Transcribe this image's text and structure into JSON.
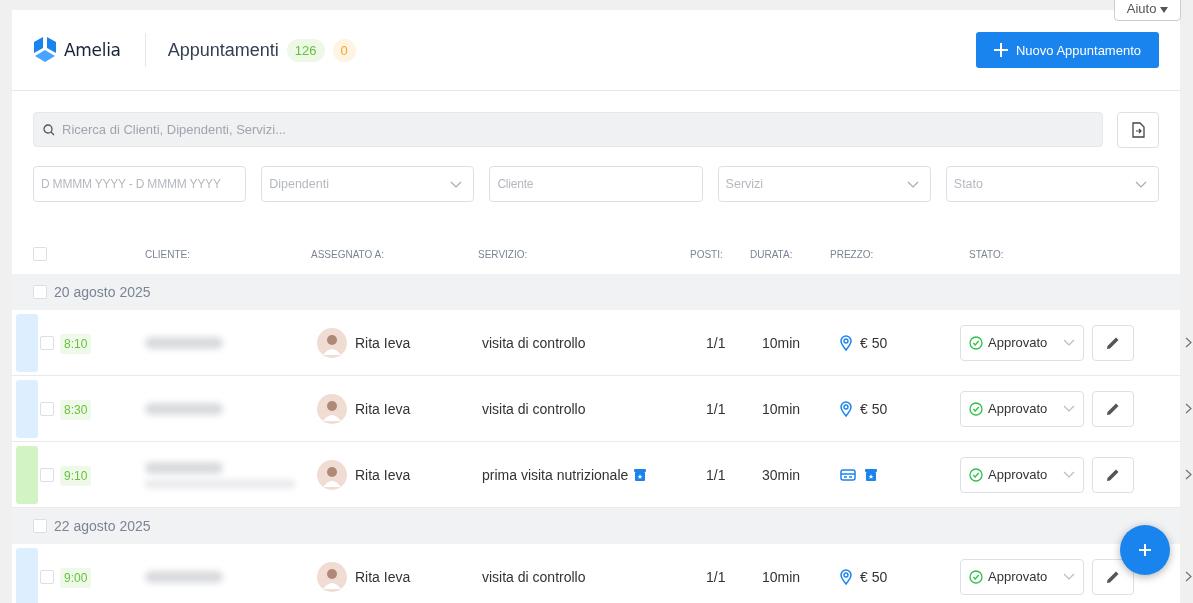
{
  "help_button": "Aiuto",
  "header": {
    "brand": "Amelia",
    "title": "Appuntamenti",
    "counts": [
      {
        "value": "126",
        "color": "#67c23a"
      },
      {
        "value": "0",
        "color": "#f5a623"
      }
    ],
    "new_button": "Nuovo Appuntamento"
  },
  "search": {
    "placeholder": "Ricerca di Clienti, Dipendenti, Servizi..."
  },
  "filters": [
    {
      "placeholder": "D MMMM YYYY - D MMMM YYYY",
      "kind": "date"
    },
    {
      "placeholder": "Dipendenti",
      "kind": "select"
    },
    {
      "placeholder": "Cliente",
      "kind": "text"
    },
    {
      "placeholder": "Servizi",
      "kind": "select"
    },
    {
      "placeholder": "Stato",
      "kind": "select"
    }
  ],
  "table": {
    "columns": [
      "CLIENTE:",
      "ASSEGNATO A:",
      "SERVIZIO:",
      "POSTI:",
      "DURATA:",
      "PREZZO:",
      "STATO:"
    ],
    "select_all_checked": false,
    "groups": [
      {
        "date": "20 agosto 2025",
        "checked": false,
        "rows": [
          {
            "color": "#ddeeff",
            "checked": false,
            "time": "8:10",
            "client_email": false,
            "employee": "Rita Ieva",
            "service": "visita di controllo",
            "package": false,
            "posti": "1/1",
            "duration": "10min",
            "location": true,
            "card": false,
            "price_package": false,
            "price": "€ 50",
            "status": "Approvato"
          },
          {
            "color": "#ddeeff",
            "checked": false,
            "time": "8:30",
            "client_email": false,
            "employee": "Rita Ieva",
            "service": "visita di controllo",
            "package": false,
            "posti": "1/1",
            "duration": "10min",
            "location": true,
            "card": false,
            "price_package": false,
            "price": "€ 50",
            "status": "Approvato"
          },
          {
            "color": "#d2f3c4",
            "checked": false,
            "time": "9:10",
            "client_email": true,
            "employee": "Rita Ieva",
            "service": "prima visita nutrizionale",
            "package": true,
            "posti": "1/1",
            "duration": "30min",
            "location": false,
            "card": true,
            "price_package": true,
            "status": "Approvato"
          }
        ]
      },
      {
        "date": "22 agosto 2025",
        "checked": false,
        "rows": [
          {
            "color": "#ddeeff",
            "checked": false,
            "time": "9:00",
            "client_email": false,
            "employee": "Rita Ieva",
            "service": "visita di controllo",
            "package": false,
            "posti": "1/1",
            "duration": "10min",
            "location": true,
            "card": false,
            "price_package": false,
            "price": "€ 50",
            "status": "Approvato"
          }
        ]
      }
    ]
  }
}
